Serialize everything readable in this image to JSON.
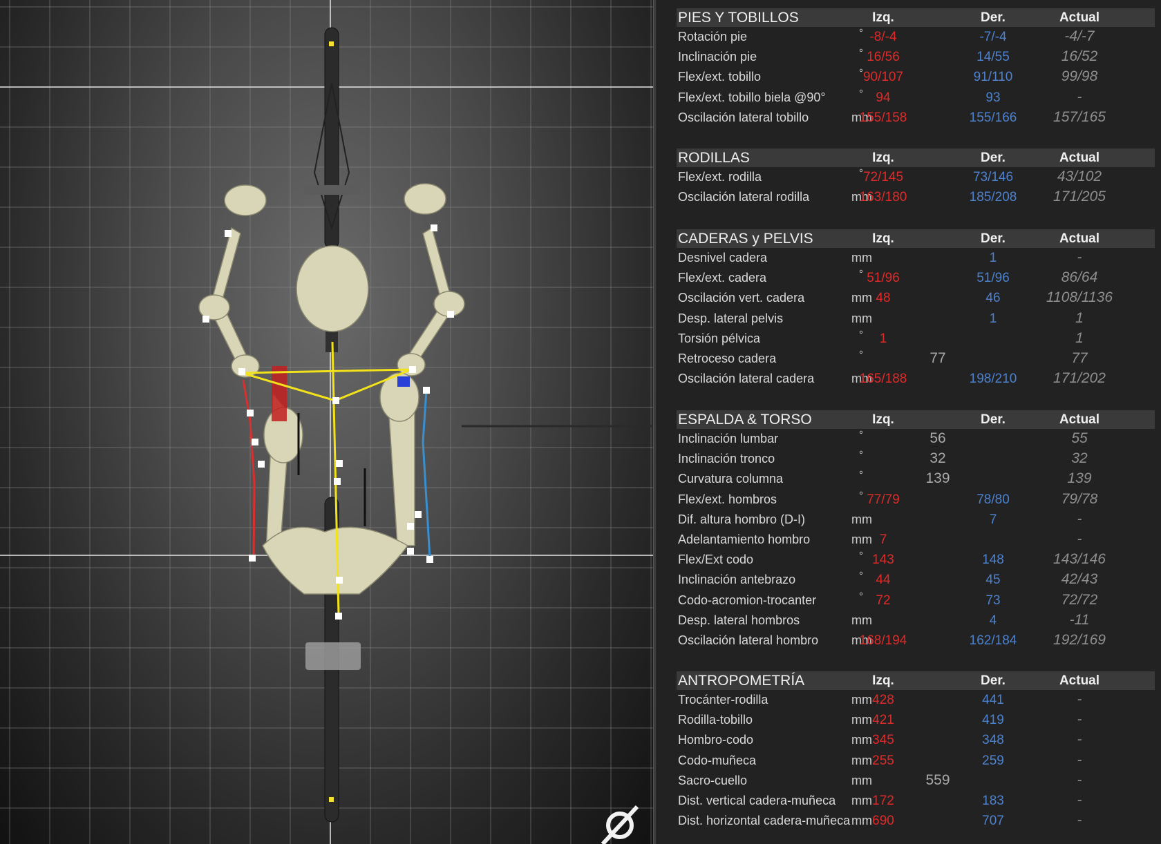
{
  "colors": {
    "left": "#e02a2a",
    "right": "#4d82cf",
    "mid": "#a8a8a8",
    "actual": "#8e8e8e",
    "section_bg": "#3a3a3a",
    "panel_bg": "#222222",
    "skeleton": "#d9d6b8",
    "hip_line": "#f2e21a"
  },
  "viewport": {
    "logo_icon": "bike-fit-logo-icon"
  },
  "sections": [
    {
      "title": "PIES Y TOBILLOS",
      "col_left": "Izq.",
      "col_right": "Der.",
      "col_actual": "Actual",
      "rows": [
        {
          "label": "Rotación pie",
          "unit": "°",
          "left": "-8/-4",
          "mid": "",
          "right": "-7/-4",
          "actual": "-4/-7"
        },
        {
          "label": "Inclinación pie",
          "unit": "°",
          "left": "16/56",
          "mid": "",
          "right": "14/55",
          "actual": "16/52"
        },
        {
          "label": "Flex/ext. tobillo",
          "unit": "°",
          "left": "90/107",
          "mid": "",
          "right": "91/110",
          "actual": "99/98"
        },
        {
          "label": "Flex/ext. tobillo biela @90°",
          "unit": "°",
          "left": "94",
          "mid": "",
          "right": "93",
          "actual": "-"
        },
        {
          "label": "Oscilación lateral tobillo",
          "unit": "mm",
          "left": "155/158",
          "mid": "",
          "right": "155/166",
          "actual": "157/165"
        }
      ]
    },
    {
      "title": "RODILLAS",
      "col_left": "Izq.",
      "col_right": "Der.",
      "col_actual": "Actual",
      "rows": [
        {
          "label": "Flex/ext. rodilla",
          "unit": "°",
          "left": "72/145",
          "mid": "",
          "right": "73/146",
          "actual": "43/102"
        },
        {
          "label": "Oscilación lateral rodilla",
          "unit": "mm",
          "left": "163/180",
          "mid": "",
          "right": "185/208",
          "actual": "171/205"
        }
      ]
    },
    {
      "title": "CADERAS y PELVIS",
      "col_left": "Izq.",
      "col_right": "Der.",
      "col_actual": "Actual",
      "rows": [
        {
          "label": "Desnivel cadera",
          "unit": "mm",
          "left": "",
          "mid": "",
          "right": "1",
          "actual": "-"
        },
        {
          "label": "Flex/ext. cadera",
          "unit": "°",
          "left": "51/96",
          "mid": "",
          "right": "51/96",
          "actual": "86/64"
        },
        {
          "label": "Oscilación vert. cadera",
          "unit": "mm",
          "left": "48",
          "mid": "",
          "right": "46",
          "actual": "1108/1136"
        },
        {
          "label": "Desp. lateral pelvis",
          "unit": "mm",
          "left": "",
          "mid": "",
          "right": "1",
          "actual": "1"
        },
        {
          "label": "Torsión pélvica",
          "unit": "°",
          "left": "1",
          "mid": "",
          "right": "",
          "actual": "1"
        },
        {
          "label": "Retroceso cadera",
          "unit": "°",
          "left": "",
          "mid": "77",
          "right": "",
          "actual": "77"
        },
        {
          "label": "Oscilación lateral cadera",
          "unit": "mm",
          "left": "165/188",
          "mid": "",
          "right": "198/210",
          "actual": "171/202"
        }
      ]
    },
    {
      "title": "ESPALDA & TORSO",
      "col_left": "Izq.",
      "col_right": "Der.",
      "col_actual": "Actual",
      "rows": [
        {
          "label": "Inclinación lumbar",
          "unit": "°",
          "left": "",
          "mid": "56",
          "right": "",
          "actual": "55"
        },
        {
          "label": "Inclinación tronco",
          "unit": "°",
          "left": "",
          "mid": "32",
          "right": "",
          "actual": "32"
        },
        {
          "label": "Curvatura columna",
          "unit": "°",
          "left": "",
          "mid": "139",
          "right": "",
          "actual": "139"
        },
        {
          "label": "Flex/ext. hombros",
          "unit": "°",
          "left": "77/79",
          "mid": "",
          "right": "78/80",
          "actual": "79/78"
        },
        {
          "label": "Dif. altura hombro (D-I)",
          "unit": "mm",
          "left": "",
          "mid": "",
          "right": "7",
          "actual": "-"
        },
        {
          "label": "Adelantamiento hombro",
          "unit": "mm",
          "left": "7",
          "mid": "",
          "right": "",
          "actual": "-"
        },
        {
          "label": "Flex/Ext codo",
          "unit": "°",
          "left": "143",
          "mid": "",
          "right": "148",
          "actual": "143/146"
        },
        {
          "label": "Inclinación antebrazo",
          "unit": "°",
          "left": "44",
          "mid": "",
          "right": "45",
          "actual": "42/43"
        },
        {
          "label": "Codo-acromion-trocanter",
          "unit": "°",
          "left": "72",
          "mid": "",
          "right": "73",
          "actual": "72/72"
        },
        {
          "label": "Desp. lateral hombros",
          "unit": "mm",
          "left": "",
          "mid": "",
          "right": "4",
          "actual": "-11"
        },
        {
          "label": "Oscilación lateral hombro",
          "unit": "mm",
          "left": "168/194",
          "mid": "",
          "right": "162/184",
          "actual": "192/169"
        }
      ]
    },
    {
      "title": "ANTROPOMETRÍA",
      "col_left": "Izq.",
      "col_right": "Der.",
      "col_actual": "Actual",
      "rows": [
        {
          "label": "Trocánter-rodilla",
          "unit": "mm",
          "left": "428",
          "mid": "",
          "right": "441",
          "actual": "-"
        },
        {
          "label": "Rodilla-tobillo",
          "unit": "mm",
          "left": "421",
          "mid": "",
          "right": "419",
          "actual": "-"
        },
        {
          "label": "Hombro-codo",
          "unit": "mm",
          "left": "345",
          "mid": "",
          "right": "348",
          "actual": "-"
        },
        {
          "label": "Codo-muñeca",
          "unit": "mm",
          "left": "255",
          "mid": "",
          "right": "259",
          "actual": "-"
        },
        {
          "label": "Sacro-cuello",
          "unit": "mm",
          "left": "",
          "mid": "559",
          "right": "",
          "actual": "-"
        },
        {
          "label": "Dist. vertical cadera-muñeca",
          "unit": "mm",
          "left": "172",
          "mid": "",
          "right": "183",
          "actual": "-"
        },
        {
          "label": "Dist. horizontal cadera-muñeca",
          "unit": "mm",
          "left": "690",
          "mid": "",
          "right": "707",
          "actual": "-"
        }
      ]
    }
  ]
}
